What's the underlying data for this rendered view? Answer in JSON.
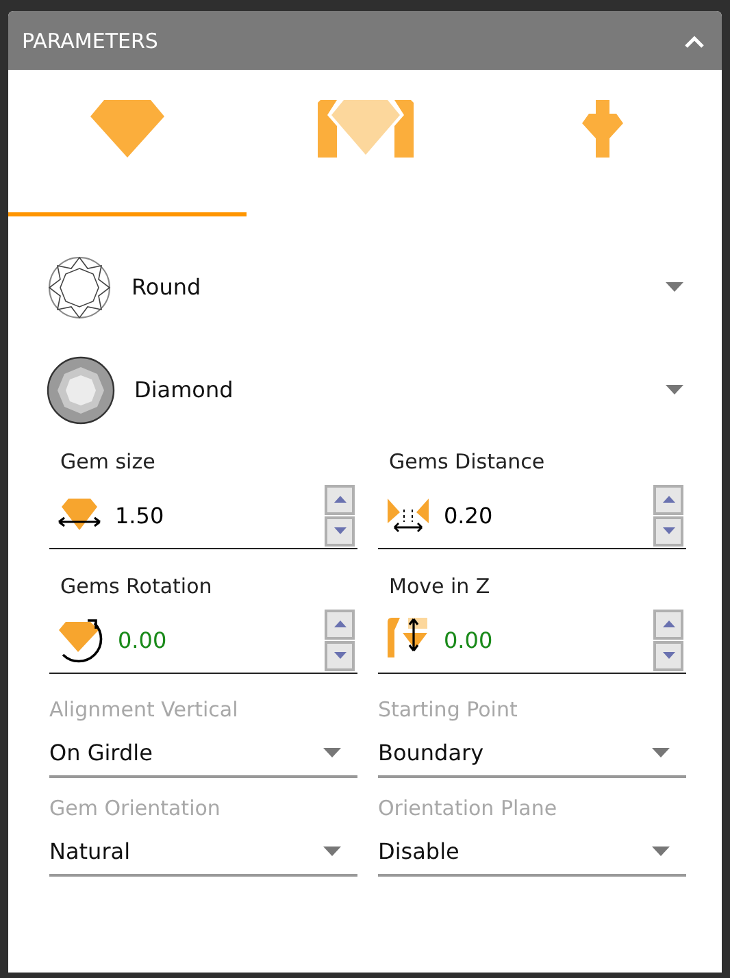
{
  "panel": {
    "title": "PARAMETERS",
    "expanded": true
  },
  "tabs": [
    {
      "kind": "gem",
      "selected": true
    },
    {
      "kind": "setting",
      "selected": false
    },
    {
      "kind": "prong",
      "selected": false
    }
  ],
  "selectors": [
    {
      "kind": "cut",
      "value": "Round"
    },
    {
      "kind": "material",
      "value": "Diamond"
    }
  ],
  "spinners": [
    {
      "label": "Gem size",
      "kind": "size",
      "value": "1.50",
      "color": "#000000"
    },
    {
      "label": "Gems Distance",
      "kind": "distance",
      "value": "0.20",
      "color": "#000000"
    },
    {
      "label": "Gems Rotation",
      "kind": "rotation",
      "value": "0.00",
      "color": "#1a8a1a"
    },
    {
      "label": "Move in Z",
      "kind": "move_z",
      "value": "0.00",
      "color": "#1a8a1a"
    }
  ],
  "dropdowns": [
    {
      "label": "Alignment Vertical",
      "value": "On Girdle"
    },
    {
      "label": "Starting Point",
      "value": "Boundary"
    },
    {
      "label": "Gem Orientation",
      "value": "Natural"
    },
    {
      "label": "Orientation Plane",
      "value": "Disable"
    }
  ]
}
